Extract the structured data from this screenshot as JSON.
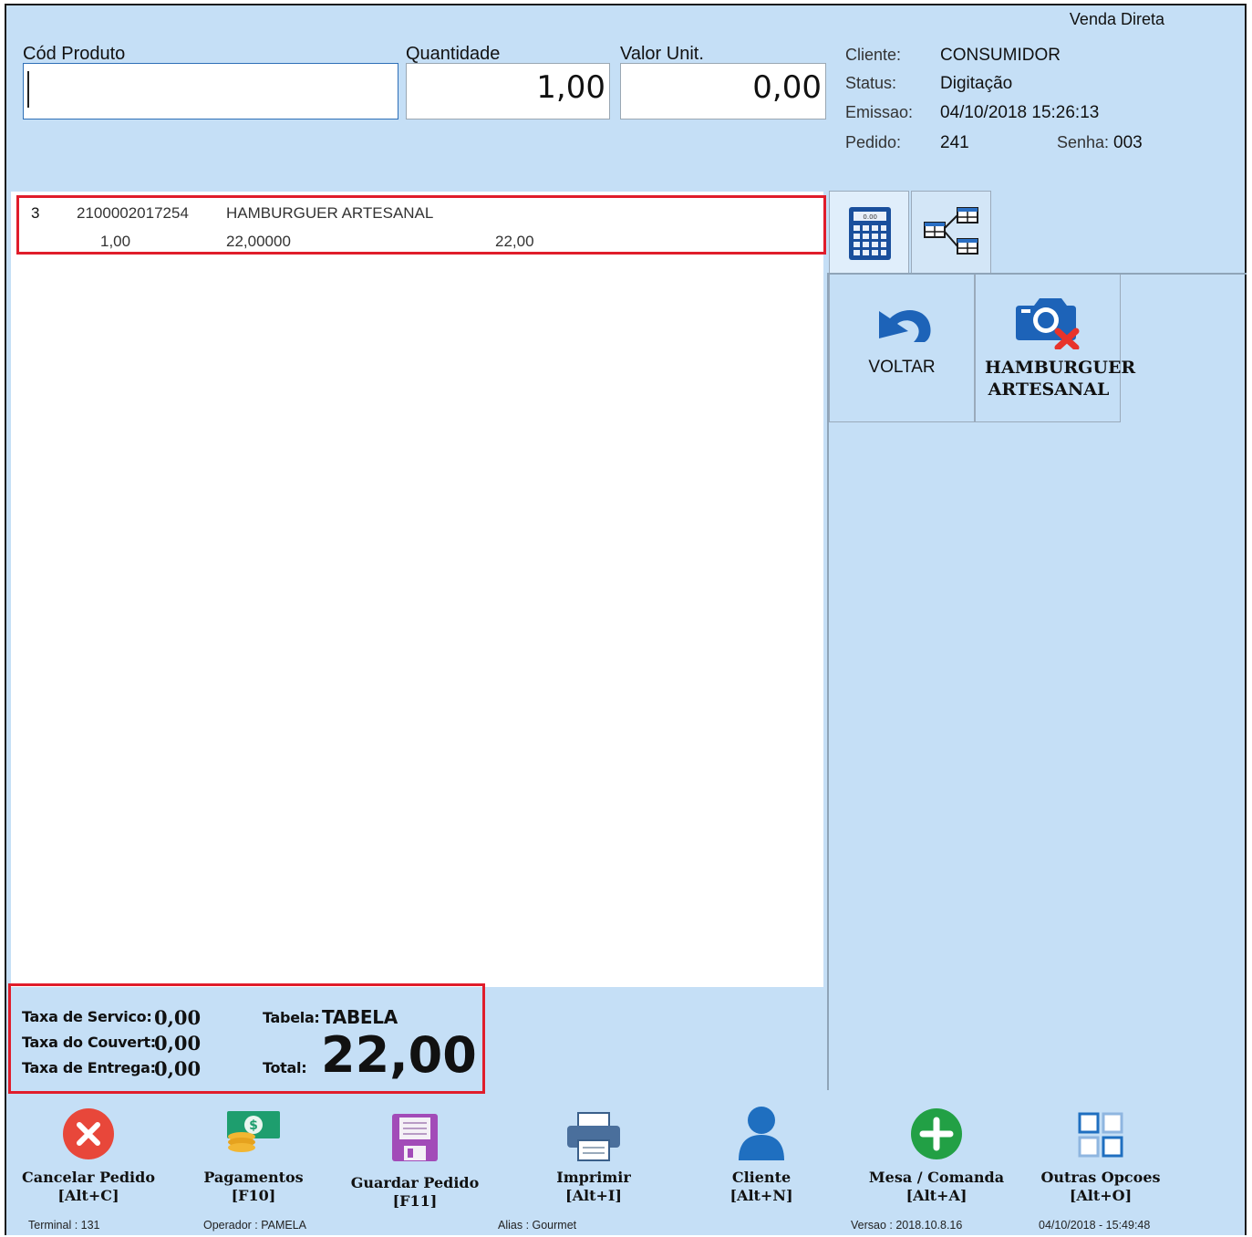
{
  "window": {
    "title": "Venda Direta"
  },
  "form": {
    "cod_label": "Cód Produto",
    "cod_value": "",
    "qty_label": "Quantidade",
    "qty_value": "1,00",
    "unit_label": "Valor Unit.",
    "unit_value": "0,00"
  },
  "info": {
    "cliente_label": "Cliente:",
    "cliente": "CONSUMIDOR",
    "status_label": "Status:",
    "status": "Digitação",
    "emissao_label": "Emissao:",
    "emissao": "04/10/2018 15:26:13",
    "pedido_label": "Pedido:",
    "pedido": "241",
    "senha_label": "Senha:",
    "senha": "003"
  },
  "items": [
    {
      "seq": "3",
      "code": "2100002017254",
      "name": "HAMBURGUER ARTESANAL",
      "qty": "1,00",
      "unit": "22,00000",
      "total": "22,00"
    }
  ],
  "tabs": [
    {
      "icon": "calculator-icon",
      "active": true
    },
    {
      "icon": "category-tree-icon",
      "active": false
    }
  ],
  "tiles": [
    {
      "label": "VOLTAR",
      "icon": "undo-arrow-icon",
      "bold": false
    },
    {
      "label": "HAMBURGUER ARTESANAL",
      "icon": "no-photo-camera-icon",
      "bold": true
    }
  ],
  "totals": {
    "servico_label": "Taxa de Servico:",
    "servico": "0,00",
    "couvert_label": "Taxa do Couvert:",
    "couvert": "0,00",
    "entrega_label": "Taxa de Entrega:",
    "entrega": "0,00",
    "tabela_label": "Tabela:",
    "tabela": "TABELA",
    "total_label": "Total:",
    "total": "22,00"
  },
  "toolbar": [
    {
      "label": "Cancelar Pedido",
      "shortcut": "[Alt+C]",
      "icon": "cancel-icon"
    },
    {
      "label": "Pagamentos",
      "shortcut": "[F10]",
      "icon": "payments-money-icon"
    },
    {
      "label": "Guardar Pedido",
      "shortcut": "[F11]",
      "icon": "save-floppy-icon"
    },
    {
      "label": "Imprimir",
      "shortcut": "[Alt+I]",
      "icon": "printer-icon"
    },
    {
      "label": "Cliente",
      "shortcut": "[Alt+N]",
      "icon": "user-icon"
    },
    {
      "label": "Mesa / Comanda",
      "shortcut": "[Alt+A]",
      "icon": "add-icon"
    },
    {
      "label": "Outras Opcoes",
      "shortcut": "[Alt+O]",
      "icon": "grid-options-icon"
    }
  ],
  "statusbar": {
    "terminal": "Terminal : 131",
    "operador": "Operador : PAMELA",
    "alias": "Alias : Gourmet",
    "versao": "Versao : 2018.10.8.16",
    "datetime": "04/10/2018 - 15:49:48"
  },
  "colors": {
    "background": "#c5dff6",
    "highlight": "#e01d2b",
    "cancel": "#e8473a",
    "add": "#22a045",
    "user": "#1f6fc0",
    "save": "#a24bb8"
  }
}
